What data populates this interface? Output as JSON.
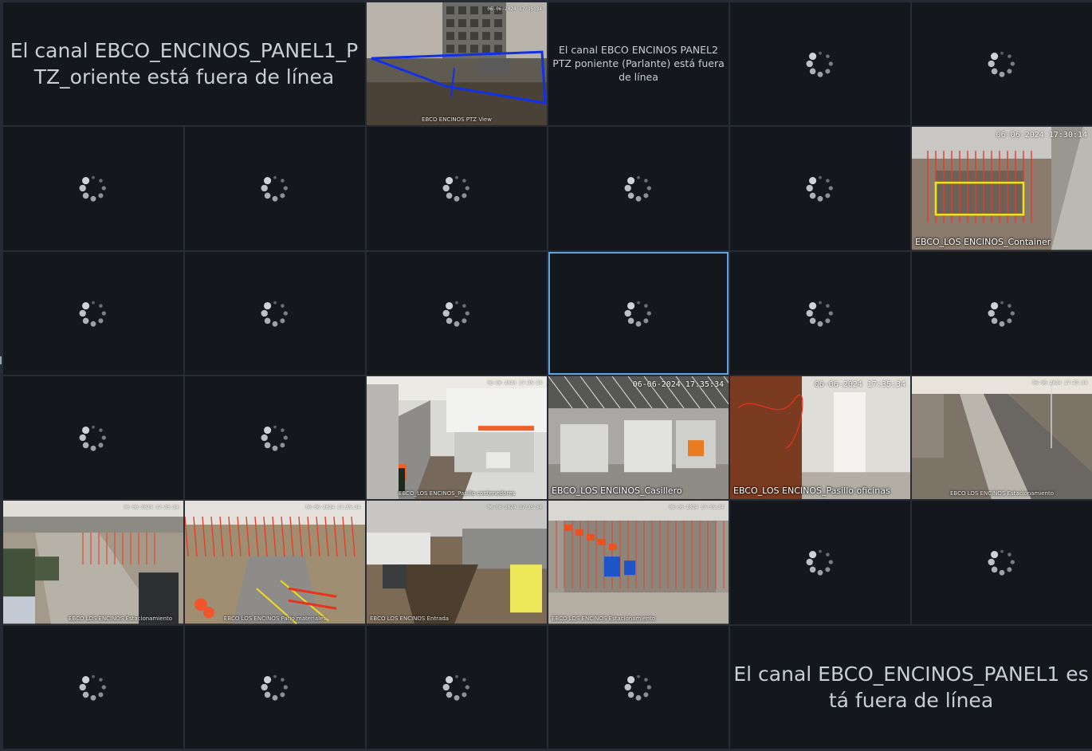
{
  "tiles": [
    {
      "kind": "offline",
      "message": "El canal EBCO_ENCINOS_PANEL1_PTZ_oriente está fuera de línea",
      "size": "large",
      "colspan": 2
    },
    {
      "kind": "camera",
      "scene": "ptz",
      "caption": "EBCO ENCINOS PTZ View",
      "stamp": "06-06-2024 17:35:34",
      "tinyCaption": true
    },
    {
      "kind": "offline",
      "message": "El canal EBCO ENCINOS PANEL2 PTZ poniente (Parlante) está fuera de línea",
      "size": "small"
    },
    {
      "kind": "loading"
    },
    {
      "kind": "loading"
    },
    {
      "kind": "loading"
    },
    {
      "kind": "loading"
    },
    {
      "kind": "loading"
    },
    {
      "kind": "loading"
    },
    {
      "kind": "loading"
    },
    {
      "kind": "camera",
      "scene": "site",
      "caption": "EBCO_LOS ENCINOS_Container",
      "stamp": "06-06-2024 17:30:14"
    },
    {
      "kind": "loading"
    },
    {
      "kind": "loading"
    },
    {
      "kind": "loading"
    },
    {
      "kind": "loading",
      "selected": true
    },
    {
      "kind": "loading"
    },
    {
      "kind": "loading"
    },
    {
      "kind": "loading"
    },
    {
      "kind": "loading"
    },
    {
      "kind": "camera",
      "scene": "yard",
      "caption": "EBCO_LOS ENCINOS_Pasillo contenedores",
      "stamp": "06-06-2024 17:35:34",
      "tinyCaption": true
    },
    {
      "kind": "camera",
      "scene": "lockers",
      "caption": "EBCO_LOS ENCINOS_Casillero",
      "stamp": "06-06-2024 17:35:34"
    },
    {
      "kind": "camera",
      "scene": "hall",
      "caption": "EBCO_LOS ENCINOS_Pasillo oficinas",
      "stamp": "06-06-2024 17:35:34"
    },
    {
      "kind": "camera",
      "scene": "road",
      "caption": "EBCO LOS ENCINOS Estacionamiento",
      "stamp": "06-06-2024 17:35:34",
      "tinyCaption": true
    },
    {
      "kind": "camera",
      "scene": "yard2",
      "caption": "EBCO LOS ENCINOS Estacionamiento",
      "stamp": "06-06-2024 17:35:34",
      "tinyCaption": true,
      "captionRight": true
    },
    {
      "kind": "camera",
      "scene": "site2",
      "caption": "EBCO LOS ENCINOS Patio materiales",
      "stamp": "06-06-2024 17:35:34",
      "tinyCaption": true
    },
    {
      "kind": "camera",
      "scene": "trench",
      "caption": "EBCO LOS ENCINOS Entrada",
      "stamp": "06-06-2024 17:35:34",
      "tinyCaption": true,
      "captionLeft": true
    },
    {
      "kind": "camera",
      "scene": "rebar",
      "caption": "EBCO LOS ENCINOS Estacionamiento",
      "stamp": "06-06-2024 17:35:34",
      "tinyCaption": true,
      "captionLeft": true
    },
    {
      "kind": "loading"
    },
    {
      "kind": "loading"
    },
    {
      "kind": "loading"
    },
    {
      "kind": "loading"
    },
    {
      "kind": "loading"
    },
    {
      "kind": "loading"
    },
    {
      "kind": "offline",
      "message": "El canal EBCO_ENCINOS_PANEL1 está fuera de línea",
      "size": "large",
      "colspan": 2
    }
  ]
}
